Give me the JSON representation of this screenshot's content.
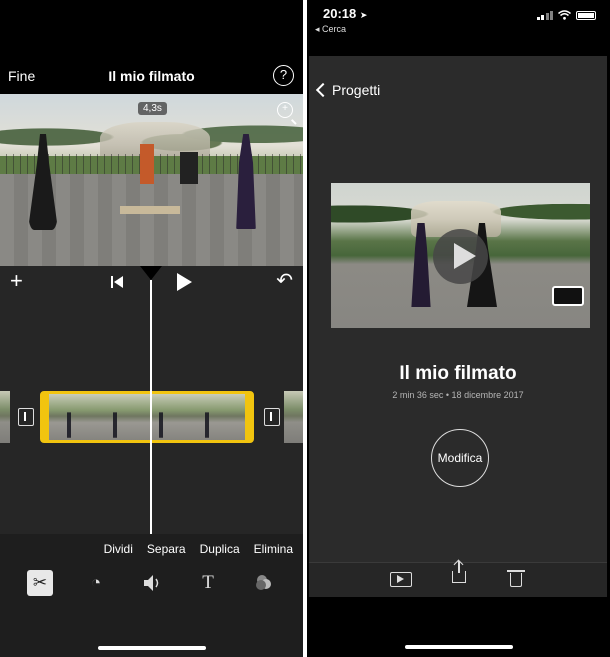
{
  "editor": {
    "done_label": "Fine",
    "title": "Il mio filmato",
    "help_icon": "question-circle-icon",
    "help_glyph": "?",
    "duration_badge": "4,3s",
    "zoom_icon": "zoom-in-icon",
    "add_icon": "plus-icon",
    "add_glyph": "+",
    "skip_icon": "skip-to-start-icon",
    "play_icon": "play-icon",
    "undo_icon": "undo-icon",
    "undo_glyph": "↶",
    "actions": [
      "Dividi",
      "Separa",
      "Duplica",
      "Elimina"
    ],
    "tools": [
      {
        "icon": "scissors-icon",
        "glyph": "✂",
        "selected": true
      },
      {
        "icon": "speed-gauge-icon",
        "glyph": "◔",
        "selected": false
      },
      {
        "icon": "volume-icon",
        "glyph": "🔊",
        "selected": false
      },
      {
        "icon": "text-title-icon",
        "glyph": "T",
        "selected": false
      },
      {
        "icon": "filters-icon",
        "glyph": "◎",
        "selected": false
      }
    ],
    "accent_color": "#f1c40f"
  },
  "project": {
    "status": {
      "time": "20:18",
      "back_label": "◂ Cerca",
      "location_icon": "location-arrow-icon",
      "signal_icon": "cellular-signal-icon",
      "wifi_icon": "wifi-icon",
      "battery_icon": "battery-icon"
    },
    "back_label": "Progetti",
    "title": "Il mio filmato",
    "subtitle": "2 min 36 sec • 18 dicembre 2017",
    "edit_button": "Modifica",
    "toolbar": [
      "play-video-icon",
      "share-icon",
      "trash-icon"
    ]
  }
}
